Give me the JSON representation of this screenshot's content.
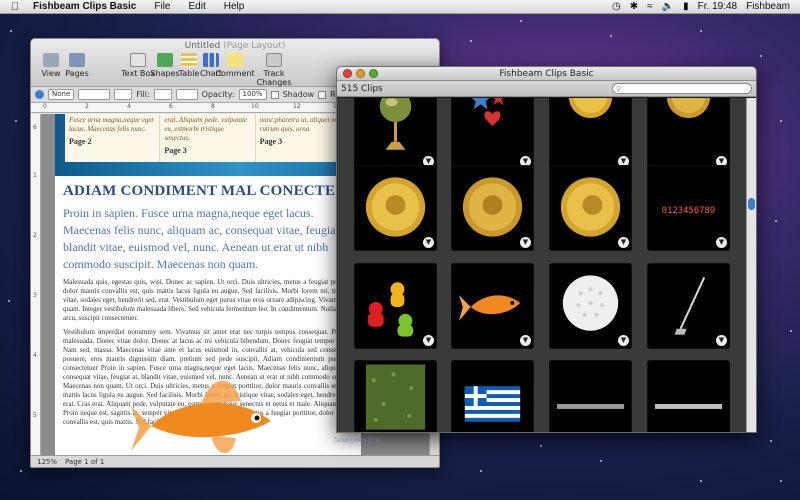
{
  "menubar": {
    "app_name": "Fishbeam Clips Basic",
    "items": [
      "File",
      "Edit",
      "Help"
    ],
    "clock": "Fr. 19:48",
    "user": "Fishbeam"
  },
  "pages_window": {
    "title": "Untitled",
    "title_sub": "(Page Layout)",
    "toolbar": [
      "View",
      "Pages",
      "Text Box",
      "Shapes",
      "Table",
      "Chart",
      "Comment",
      "Track Changes"
    ],
    "format_bar": {
      "none1": "None",
      "fill_label": "Fill:",
      "opacity_label": "Opacity:",
      "opacity_value": "100%",
      "shadow_label": "Shadow",
      "reflection_label": "Refl"
    },
    "ruler_ticks": [
      "0",
      "2",
      "4",
      "6",
      "8",
      "10",
      "12",
      "14"
    ],
    "vruler_ticks": [
      "6",
      "1",
      "2",
      "3",
      "4",
      "5",
      "6"
    ],
    "band_cards": [
      {
        "text": "Fusce urna magna,neque eget lacus. Maecenas felis nunc.",
        "page": "Page 2"
      },
      {
        "text": "erat. Aliquam pede. vulputate eu, estmorbi tristique senectus.",
        "page": "Page 3"
      },
      {
        "text": "nunc.pharetra ut, aliquet non, rutrum quis, urna.",
        "page": "Page 3"
      }
    ],
    "heading": "ADIAM CONDIMENT MAL CONECTER",
    "lead": "Proin in sapien. Fusce urna magna,neque eget lacus. Maecenas felis nunc, aliquam ac, consequat vitae, feugiat at, blandit vitae, euismod vel, nunc. Aenean ut erat ut nibh commodo suscipit. Maecenas non quam.",
    "body_1": "Malesuada quis, egestas quis, wisi. Donec ac sapien. Ut orci. Duis ultricies, metus a feugiat porttitor, dolor mauris convallis est, quis mattis lacus ligula eu augue. Sed facilisis. Morbi lorem mi, tristique vitae, sodales eget, hendrerit sed, erat. Vestibulum eget purus vitae eros ornare adipiscing. Vivamus nec quam. Integer vestibulum malesuada libero. Sed vehicula fermentum leo. In condimentum. Nullam wisi arcu, suscipit consectetuer.",
    "body_2": "Vestibulum imperdiet nonummy sem. Vivamus sit amet erat nec turpis tempus consequat. Praesent malesuada. Donec vitae dolor. Donec at lacus ac mi vehicula bibendum. Donec feugiat tempor libero. Nam sed, massa. Maecenas vitae ante et lacus euismod in, convallis at, vehicula sed consectetuer posuere, eros mauris dignissim diam, pretium sed pede suscipit. Adiam condimentum purus, in consectetuer Proin in sapien. Fusce urna magna,neque eget lacus. Maecenas felis nunc, aliquam ac, consequat vitae, feugiat at, blandit vitae, euismod vel, nunc. Aenean ut erat ut nibh commodo suscipit. Maecenas non quam. Ut orci. Duis ultricies, metus a feugiat porttitor, dolor mauris convallis est, quis mattis lacus ligula eu augue. Sed facilisis. Morbi lorem mi, tristique vitae, sodales eget, hendrerit sed, erat. Cras erat. Aliquam pede. vulputate eu, estmorbi tristique senectus et netus et male. Aliquam pede. Proin neque est, sagittis at, semper vitae. Ut orci. Duis ultricies, metus a feugiat porttitor, dolor mauris convallis est, quis mattis. Sed facilisis. Morbi lorem mi, tristique.",
    "status": {
      "zoom": "125%",
      "page": "Page 1 of 1"
    }
  },
  "clips_window": {
    "title": "Fishbeam Clips Basic",
    "count": "515 Clips",
    "search_placeholder": "",
    "clips": [
      "globe",
      "stars-heart",
      "coin-1",
      "coin-2",
      "coin-3",
      "coin-4",
      "coin-5",
      "led-numbers",
      "gummy-bears",
      "goldfish",
      "golf-ball",
      "golf-club",
      "grass",
      "greece-flag",
      "text-strip-1",
      "text-strip-2"
    ],
    "led_text": "0123456789",
    "below_text": "lacus cenas felis."
  },
  "colors": {
    "heading": "#2a4d8a",
    "lead": "#4e73b3",
    "scroll_thumb": "#3f7ad2"
  }
}
